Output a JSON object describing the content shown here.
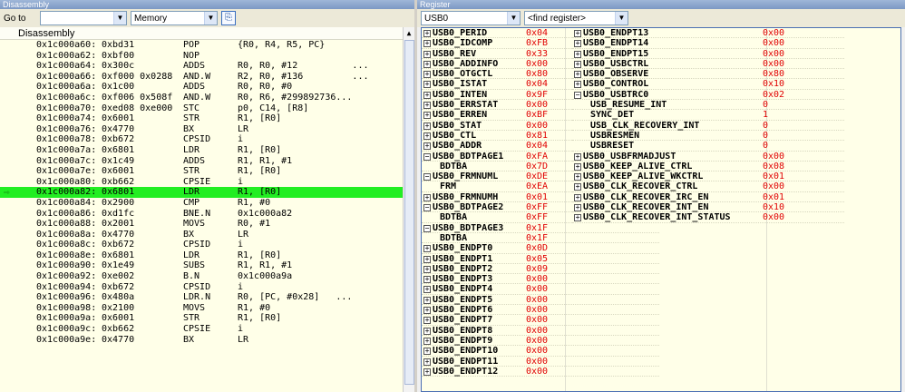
{
  "disassembly": {
    "title": "Disassembly",
    "goto_label": "Go to",
    "goto_value": "",
    "memory_value": "Memory",
    "header": "Disassembly",
    "rows": [
      [
        "0x1c000a60:",
        "0xbd31",
        "POP",
        "{R0, R4, R5, PC}"
      ],
      [
        "0x1c000a62:",
        "0xbf00",
        "NOP",
        ""
      ],
      [
        "0x1c000a64:",
        "0x300c",
        "ADDS",
        "R0, R0, #12          ..."
      ],
      [
        "0x1c000a66:",
        "0xf000 0x0288",
        "AND.W",
        "R2, R0, #136         ..."
      ],
      [
        "0x1c000a6a:",
        "0x1c00",
        "ADDS",
        "R0, R0, #0"
      ],
      [
        "0x1c000a6c:",
        "0xf006 0x508f",
        "AND.W",
        "R0, R6, #299892736..."
      ],
      [
        "0x1c000a70:",
        "0xed08 0xe000",
        "STC",
        "p0, C14, [R8]"
      ],
      [
        "0x1c000a74:",
        "0x6001",
        "STR",
        "R1, [R0]"
      ],
      [
        "0x1c000a76:",
        "0x4770",
        "BX",
        "LR"
      ],
      [
        "0x1c000a78:",
        "0xb672",
        "CPSID",
        "i"
      ],
      [
        "0x1c000a7a:",
        "0x6801",
        "LDR",
        "R1, [R0]"
      ],
      [
        "0x1c000a7c:",
        "0x1c49",
        "ADDS",
        "R1, R1, #1"
      ],
      [
        "0x1c000a7e:",
        "0x6001",
        "STR",
        "R1, [R0]"
      ],
      [
        "0x1c000a80:",
        "0xb662",
        "CPSIE",
        "i"
      ],
      [
        "0x1c000a82:",
        "0x6801",
        "LDR",
        "R1, [R0]"
      ],
      [
        "0x1c000a84:",
        "0x2900",
        "CMP",
        "R1, #0"
      ],
      [
        "0x1c000a86:",
        "0xd1fc",
        "BNE.N",
        "0x1c000a82"
      ],
      [
        "0x1c000a88:",
        "0x2001",
        "MOVS",
        "R0, #1"
      ],
      [
        "0x1c000a8a:",
        "0x4770",
        "BX",
        "LR"
      ],
      [
        "0x1c000a8c:",
        "0xb672",
        "CPSID",
        "i"
      ],
      [
        "0x1c000a8e:",
        "0x6801",
        "LDR",
        "R1, [R0]"
      ],
      [
        "0x1c000a90:",
        "0x1e49",
        "SUBS",
        "R1, R1, #1"
      ],
      [
        "0x1c000a92:",
        "0xe002",
        "B.N",
        "0x1c000a9a"
      ],
      [
        "0x1c000a94:",
        "0xb672",
        "CPSID",
        "i"
      ],
      [
        "0x1c000a96:",
        "0x480a",
        "LDR.N",
        "R0, [PC, #0x28]   ..."
      ],
      [
        "0x1c000a98:",
        "0x2100",
        "MOVS",
        "R1, #0"
      ],
      [
        "0x1c000a9a:",
        "0x6001",
        "STR",
        "R1, [R0]"
      ],
      [
        "0x1c000a9c:",
        "0xb662",
        "CPSIE",
        "i"
      ],
      [
        "0x1c000a9e:",
        "0x4770",
        "BX",
        "LR"
      ]
    ],
    "current_index": 14
  },
  "register": {
    "title": "Register",
    "module_value": "USB0",
    "find_placeholder": "<find register>",
    "left": [
      [
        "+",
        "USB0_PERID",
        "0x04",
        0
      ],
      [
        "+",
        "USB0_IDCOMP",
        "0xFB",
        0
      ],
      [
        "+",
        "USB0_REV",
        "0x33",
        0
      ],
      [
        "+",
        "USB0_ADDINFO",
        "0x00",
        0
      ],
      [
        "+",
        "USB0_OTGCTL",
        "0x80",
        0
      ],
      [
        "+",
        "USB0_ISTAT",
        "0x04",
        0
      ],
      [
        "+",
        "USB0_INTEN",
        "0x9F",
        0
      ],
      [
        "+",
        "USB0_ERRSTAT",
        "0x00",
        0
      ],
      [
        "+",
        "USB0_ERREN",
        "0xBF",
        0
      ],
      [
        "+",
        "USB0_STAT",
        "0x00",
        0
      ],
      [
        "+",
        "USB0_CTL",
        "0x81",
        0
      ],
      [
        "+",
        "USB0_ADDR",
        "0x04",
        0
      ],
      [
        "-",
        "USB0_BDTPAGE1",
        "0xFA",
        0
      ],
      [
        "",
        "BDTBA",
        "0x7D",
        1
      ],
      [
        "-",
        "USB0_FRMNUML",
        "0xDE",
        0
      ],
      [
        "",
        "FRM",
        "0xEA",
        1
      ],
      [
        "+",
        "USB0_FRMNUMH",
        "0x01",
        0
      ],
      [
        "-",
        "USB0_BDTPAGE2",
        "0xFF",
        0
      ],
      [
        "",
        "BDTBA",
        "0xFF",
        1
      ],
      [
        "-",
        "USB0_BDTPAGE3",
        "0x1F",
        0
      ],
      [
        "",
        "BDTBA",
        "0x1F",
        1
      ],
      [
        "+",
        "USB0_ENDPT0",
        "0x0D",
        0
      ],
      [
        "+",
        "USB0_ENDPT1",
        "0x05",
        0
      ],
      [
        "+",
        "USB0_ENDPT2",
        "0x09",
        0
      ],
      [
        "+",
        "USB0_ENDPT3",
        "0x00",
        0
      ],
      [
        "+",
        "USB0_ENDPT4",
        "0x00",
        0
      ],
      [
        "+",
        "USB0_ENDPT5",
        "0x00",
        0
      ],
      [
        "+",
        "USB0_ENDPT6",
        "0x00",
        0
      ],
      [
        "+",
        "USB0_ENDPT7",
        "0x00",
        0
      ],
      [
        "+",
        "USB0_ENDPT8",
        "0x00",
        0
      ],
      [
        "+",
        "USB0_ENDPT9",
        "0x00",
        0
      ],
      [
        "+",
        "USB0_ENDPT10",
        "0x00",
        0
      ],
      [
        "+",
        "USB0_ENDPT11",
        "0x00",
        0
      ],
      [
        "+",
        "USB0_ENDPT12",
        "0x00",
        0
      ]
    ],
    "right": [
      [
        "+",
        "USB0_ENDPT13",
        "0x00",
        0
      ],
      [
        "+",
        "USB0_ENDPT14",
        "0x00",
        0
      ],
      [
        "+",
        "USB0_ENDPT15",
        "0x00",
        0
      ],
      [
        "+",
        "USB0_USBCTRL",
        "0x00",
        0
      ],
      [
        "+",
        "USB0_OBSERVE",
        "0x80",
        0
      ],
      [
        "+",
        "USB0_CONTROL",
        "0x10",
        0
      ],
      [
        "-",
        "USB0_USBTRC0",
        "0x02",
        0
      ],
      [
        "",
        "USB_RESUME_INT",
        "0",
        1
      ],
      [
        "",
        "SYNC_DET",
        "1",
        1
      ],
      [
        "",
        "USB_CLK_RECOVERY_INT",
        "0",
        1
      ],
      [
        "",
        "USBRESMEN",
        "0",
        1
      ],
      [
        "",
        "USBRESET",
        "0",
        1
      ],
      [
        "+",
        "USB0_USBFRMADJUST",
        "0x00",
        0
      ],
      [
        "+",
        "USB0_KEEP_ALIVE_CTRL",
        "0x08",
        0
      ],
      [
        "+",
        "USB0_KEEP_ALIVE_WKCTRL",
        "0x01",
        0
      ],
      [
        "+",
        "USB0_CLK_RECOVER_CTRL",
        "0x00",
        0
      ],
      [
        "+",
        "USB0_CLK_RECOVER_IRC_EN",
        "0x01",
        0
      ],
      [
        "+",
        "USB0_CLK_RECOVER_INT_EN",
        "0x10",
        0
      ],
      [
        "+",
        "USB0_CLK_RECOVER_INT_STATUS",
        "0x00",
        0
      ]
    ]
  }
}
